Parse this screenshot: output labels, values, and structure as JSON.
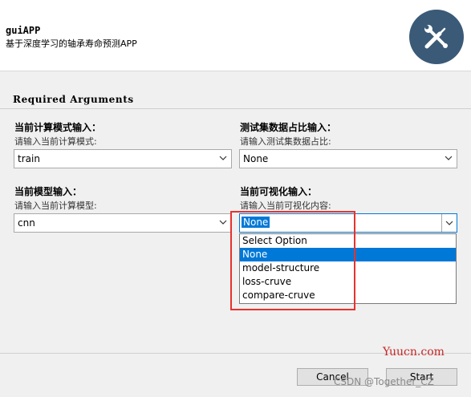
{
  "header": {
    "title": "guiAPP",
    "subtitle": "基于深度学习的轴承寿命预测APP",
    "logo_icon": "wrench-screwdriver-icon",
    "logo_color": "#3a5a78"
  },
  "section": {
    "title": "Required Arguments"
  },
  "fields": {
    "mode": {
      "label": "当前计算模式输入：",
      "hint": "请输入当前计算模式:",
      "value": "train"
    },
    "test_ratio": {
      "label": "测试集数据占比输入：",
      "hint": "请输入测试集数据占比:",
      "value": "None"
    },
    "model": {
      "label": "当前模型输入：",
      "hint": "请输入当前计算模型:",
      "value": "cnn"
    },
    "visualization": {
      "label": "当前可视化输入：",
      "hint": "请输入当前可视化内容:",
      "value": "None",
      "options": [
        "Select Option",
        "None",
        "model-structure",
        "loss-cruve",
        "compare-cruve"
      ],
      "selected_option": "None"
    }
  },
  "footer": {
    "cancel_label": "Cancel",
    "start_label": "Start"
  },
  "watermarks": {
    "site": "Yuucn.com",
    "csdn": "CSDN @Together_CZ"
  },
  "colors": {
    "accent": "#0078d7",
    "highlight_box": "#e8322d"
  }
}
